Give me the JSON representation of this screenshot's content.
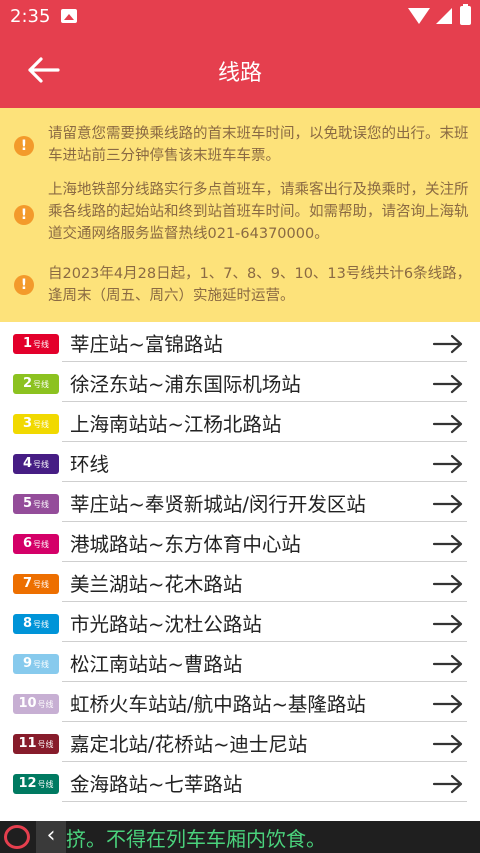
{
  "status_bar": {
    "time": "2:35"
  },
  "header": {
    "title": "线路"
  },
  "notices": [
    {
      "text": "请留意您需要换乘线路的首末班车时间，以免耽误您的出行。末班车进站前三分钟停售该末班车车票。"
    },
    {
      "text": "上海地铁部分线路实行多点首班车，请乘客出行及换乘时，关注所乘各线路的起始站和终到站首班车时间。如需帮助，请咨询上海轨道交通网络服务监督热线021-64370000。"
    },
    {
      "text": "自2023年4月28日起，1、7、8、9、10、13号线共计6条线路，逢周末（周五、周六）实施延时运营。"
    }
  ],
  "lines": [
    {
      "num": "1",
      "suffix": "号线",
      "route": "莘庄站~富锦路站",
      "color": "#e3002b"
    },
    {
      "num": "2",
      "suffix": "号线",
      "route": "徐泾东站~浦东国际机场站",
      "color": "#8cc220"
    },
    {
      "num": "3",
      "suffix": "号线",
      "route": "上海南站站~江杨北路站",
      "color": "#f1d900"
    },
    {
      "num": "4",
      "suffix": "号线",
      "route": "环线",
      "color": "#461d84"
    },
    {
      "num": "5",
      "suffix": "号线",
      "route": "莘庄站~奉贤新城站/闵行开发区站",
      "color": "#944d9a"
    },
    {
      "num": "6",
      "suffix": "号线",
      "route": "港城路站~东方体育中心站",
      "color": "#d40068"
    },
    {
      "num": "7",
      "suffix": "号线",
      "route": "美兰湖站~花木路站",
      "color": "#ed6f00"
    },
    {
      "num": "8",
      "suffix": "号线",
      "route": "市光路站~沈杜公路站",
      "color": "#0094d8"
    },
    {
      "num": "9",
      "suffix": "号线",
      "route": "松江南站站~曹路站",
      "color": "#87caed"
    },
    {
      "num": "10",
      "suffix": "号线",
      "route": "虹桥火车站站/航中路站~基隆路站",
      "color": "#c7afd3"
    },
    {
      "num": "11",
      "suffix": "号线",
      "route": "嘉定北站/花桥站~迪士尼站",
      "color": "#871c2b"
    },
    {
      "num": "12",
      "suffix": "号线",
      "route": "金海路站~七莘路站",
      "color": "#007a61"
    }
  ],
  "bottom_bar": {
    "chevron": "‹",
    "marquee": "挤。不得在列车车厢内饮食。"
  },
  "colors": {
    "primary": "#e53f4e",
    "notice_bg": "#fde27a",
    "notice_text": "#8a6a43",
    "notice_icon": "#f39a2b",
    "marquee": "#4ad27c"
  }
}
